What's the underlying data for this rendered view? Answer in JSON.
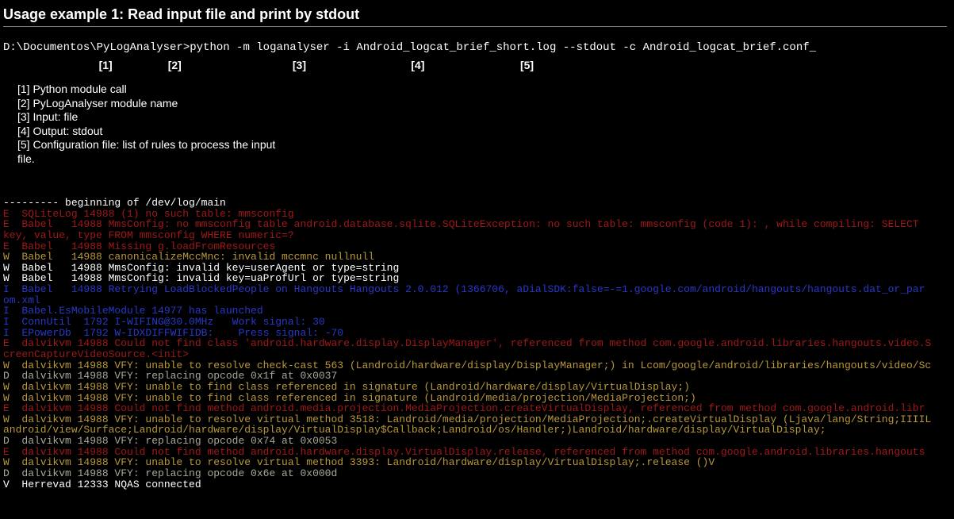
{
  "title": "Usage example 1: Read input file and print by stdout",
  "command": {
    "prompt": "D:\\Documentos\\PyLogAnalyser>",
    "parts": {
      "p1": "python -m",
      "p2": "loganalyser",
      "p3": "-i Android_logcat_brief_short.log",
      "p4": "--stdout",
      "p5": "-c Android_logcat_brief.conf_"
    },
    "labels": {
      "l1": "[1]",
      "l2": "[2]",
      "l3": "[3]",
      "l4": "[4]",
      "l5": "[5]"
    }
  },
  "legend": [
    "[1] Python module call",
    "[2] PyLogAnalyser module name",
    "[3] Input: file",
    "[4] Output: stdout",
    "[5] Configuration file: list of rules to process the input",
    "      file."
  ],
  "log_lines": [
    {
      "cls": "w",
      "text": "--------- beginning of /dev/log/main"
    },
    {
      "cls": "r",
      "text": "E  SQLiteLog 14988 (1) no such table: mmsconfig"
    },
    {
      "cls": "r",
      "text": "E  Babel   14988 MmsConfig: no mmsconfig table android.database.sqlite.SQLiteException: no such table: mmsconfig (code 1): , while compiling: SELECT"
    },
    {
      "cls": "r",
      "text": "key, value, type FROM mmsconfig WHERE numeric=?"
    },
    {
      "cls": "r",
      "text": "E  Babel   14988 Missing g.loadFromResources"
    },
    {
      "cls": "y",
      "text": "W  Babel   14988 canonicalizeMccMnc: invalid mccmnc nullnull"
    },
    {
      "cls": "w",
      "text": "W  Babel   14988 MmsConfig: invalid key=userAgent or type=string"
    },
    {
      "cls": "w",
      "text": "W  Babel   14988 MmsConfig: invalid key=uaProfUrl or type=string"
    },
    {
      "cls": "b",
      "text": "I  Babel   14988 Retrying LoadBlockedPeople on Hangouts Hangouts 2.0.012 (1366706, aDialSDK:false=-=1.google.com/android/hangouts/hangouts.dat_or_par"
    },
    {
      "cls": "b",
      "text": "om.xml"
    },
    {
      "cls": "b",
      "text": "I  Babel.EsMobileModule 14977 has launched"
    },
    {
      "cls": "b",
      "text": "I  ConnUtil  1792 I-WIFING@30.0MHz   Work signal: 30"
    },
    {
      "cls": "b",
      "text": "I  EPowerDb  1792 W-IDXDIFFWIFIDB:    Press signal: -70"
    },
    {
      "cls": "r",
      "text": "E  dalvikvm 14988 Could not find class 'android.hardware.display.DisplayManager', referenced from method com.google.android.libraries.hangouts.video.S"
    },
    {
      "cls": "r",
      "text": "creenCaptureVideoSource.<init>"
    },
    {
      "cls": "y",
      "text": "W  dalvikvm 14988 VFY: unable to resolve check-cast 563 (Landroid/hardware/display/DisplayManager;) in Lcom/google/android/libraries/hangouts/video/Sc"
    },
    {
      "cls": "g",
      "text": "D  dalvikvm 14988 VFY: replacing opcode 0x1f at 0x0037"
    },
    {
      "cls": "y",
      "text": "W  dalvikvm 14988 VFY: unable to find class referenced in signature (Landroid/hardware/display/VirtualDisplay;)"
    },
    {
      "cls": "y",
      "text": "W  dalvikvm 14988 VFY: unable to find class referenced in signature (Landroid/media/projection/MediaProjection;)"
    },
    {
      "cls": "r",
      "text": "E  dalvikvm 14988 Could not find method android.media.projection.MediaProjection.createVirtualDisplay, referenced from method com.google.android.libr"
    },
    {
      "cls": "y",
      "text": "W  dalvikvm 14988 VFY: unable to resolve virtual method 3518: Landroid/media/projection/MediaProjection;.createVirtualDisplay (Ljava/lang/String;IIIIL"
    },
    {
      "cls": "y",
      "text": "android/view/Surface;Landroid/hardware/display/VirtualDisplay$Callback;Landroid/os/Handler;)Landroid/hardware/display/VirtualDisplay;"
    },
    {
      "cls": "g",
      "text": "D  dalvikvm 14988 VFY: replacing opcode 0x74 at 0x0053"
    },
    {
      "cls": "r",
      "text": "E  dalvikvm 14988 Could not find method android.hardware.display.VirtualDisplay.release, referenced from method com.google.android.libraries.hangouts"
    },
    {
      "cls": "y",
      "text": "W  dalvikvm 14988 VFY: unable to resolve virtual method 3393: Landroid/hardware/display/VirtualDisplay;.release ()V"
    },
    {
      "cls": "g",
      "text": "D  dalvikvm 14988 VFY: replacing opcode 0x6e at 0x000d"
    },
    {
      "cls": "w",
      "text": "V  Herrevad 12333 NQAS connected"
    }
  ]
}
